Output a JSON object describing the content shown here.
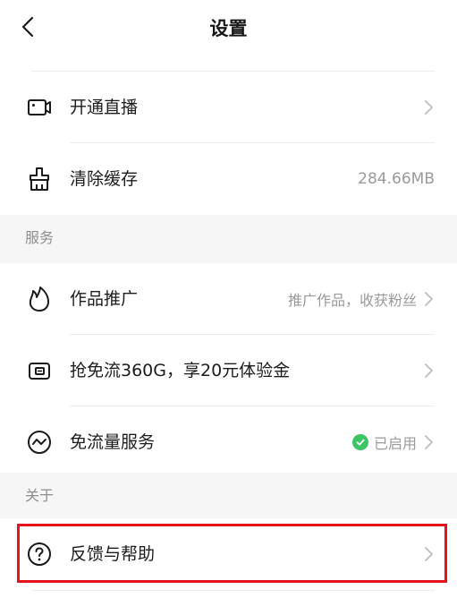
{
  "header": {
    "title": "设置",
    "back_icon": "chevron-left-icon"
  },
  "rows": {
    "live": {
      "label": "开通直播",
      "icon": "camera-icon"
    },
    "cache": {
      "label": "清除缓存",
      "value": "284.66MB",
      "icon": "broom-icon"
    },
    "promo": {
      "label": "作品推广",
      "value": "推广作品，收获粉丝",
      "icon": "flame-icon"
    },
    "data": {
      "label": "抢免流360G，享20元体验金",
      "icon": "card-icon"
    },
    "free": {
      "label": "免流量服务",
      "value": "已启用",
      "icon": "wave-circle-icon",
      "status_color": "#3dc465"
    },
    "help": {
      "label": "反馈与帮助",
      "icon": "question-circle-icon"
    }
  },
  "sections": {
    "service": "服务",
    "about": "关于"
  },
  "colors": {
    "highlight": "#e5141c",
    "section_bg": "#f6f6f6"
  }
}
